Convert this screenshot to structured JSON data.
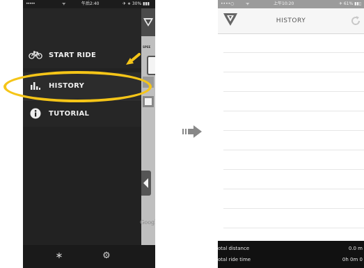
{
  "left_screen": {
    "status_bar": {
      "carrier": "•••••",
      "wifi": "ᯤ",
      "time": "午后2:40",
      "battery": "✈ ∗ 30% ▮▮▮"
    },
    "menu": [
      {
        "label": "START RIDE",
        "icon": "bicycle-icon"
      },
      {
        "label": "HISTORY",
        "icon": "bar-chart-icon"
      },
      {
        "label": "TUTORIAL",
        "icon": "info-icon"
      }
    ],
    "side_panel": {
      "speed_label": "SPEE",
      "google_text": "Google"
    },
    "bottom_bar": {
      "icons": [
        "bluetooth-icon",
        "gear-icon"
      ],
      "bluetooth_glyph": "∗",
      "gear_glyph": "⚙"
    },
    "highlight_color": "#f5c518"
  },
  "right_screen": {
    "status_bar": {
      "carrier": "••••○",
      "wifi": "ᯤ",
      "time": "上午10:20",
      "battery": "✈ 61% ▮▮▯"
    },
    "header": {
      "title": "HISTORY",
      "logo_icon": "brand-logo-icon",
      "refresh_icon": "refresh-icon"
    },
    "footer": {
      "rows": [
        {
          "label": "otal distance",
          "value": "0.0 m"
        },
        {
          "label": "otal ride time",
          "value": "0h 0m 0"
        }
      ]
    }
  }
}
